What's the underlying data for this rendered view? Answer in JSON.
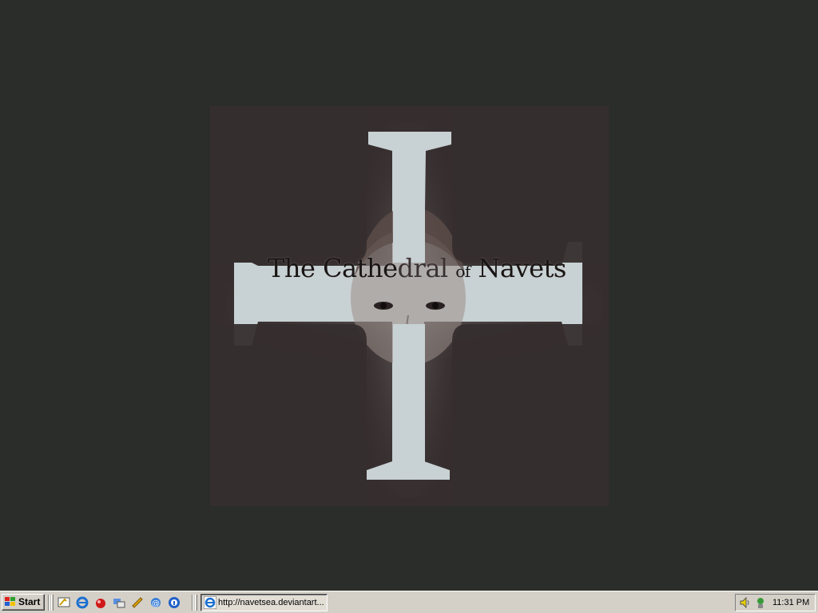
{
  "wallpaper": {
    "title_part1": "The Cathe",
    "title_part2": "dral",
    "title_of": "of",
    "title_part3": "Navets"
  },
  "taskbar": {
    "start_label": "Start",
    "quick_launch": [
      "show-desktop-icon",
      "internet-explorer-icon",
      "app-icon-red",
      "transfer-icon",
      "winamp-icon",
      "outlook-icon",
      "info-icon"
    ],
    "task_button_label": "http://navetsea.deviantart...",
    "clock": "11:31 PM"
  },
  "colors": {
    "desktop_bg": "#2b2d2a",
    "taskbar_bg": "#d4d0c8",
    "wallpaper_bg": "#362e2e",
    "cross": "#c7d0d2"
  }
}
